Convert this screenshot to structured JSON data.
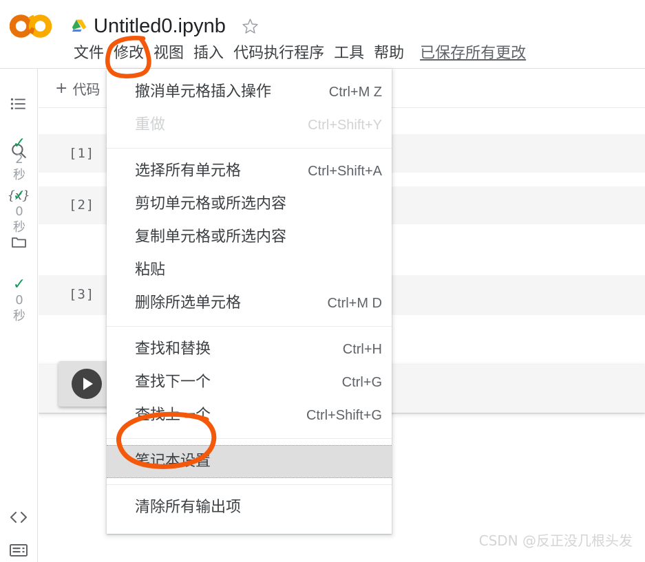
{
  "app": {
    "name": "Google Colaboratory",
    "logo_label": "CO"
  },
  "header": {
    "drive_icon": "drive-icon",
    "notebook_title": "Untitled0.ipynb",
    "star_icon": "star-icon",
    "menus": [
      {
        "label": "文件",
        "name": "menu-file"
      },
      {
        "label": "修改",
        "name": "menu-edit"
      },
      {
        "label": "视图",
        "name": "menu-view"
      },
      {
        "label": "插入",
        "name": "menu-insert"
      },
      {
        "label": "代码执行程序",
        "name": "menu-runtime"
      },
      {
        "label": "工具",
        "name": "menu-tools"
      },
      {
        "label": "帮助",
        "name": "menu-help"
      }
    ],
    "save_status": "已保存所有更改"
  },
  "sidebar": {
    "items": [
      {
        "name": "toc-icon",
        "label": "目录"
      },
      {
        "name": "search-icon",
        "label": "查找和替换"
      },
      {
        "name": "variables-icon",
        "label": "变量"
      },
      {
        "name": "files-icon",
        "label": "文件"
      }
    ],
    "bottom_items": [
      {
        "name": "code-snippets-icon",
        "label": "代码段"
      },
      {
        "name": "terminal-icon",
        "label": "终端"
      }
    ]
  },
  "toolbar": {
    "add_code_plus": "+",
    "add_code_label": "代码"
  },
  "notebook": {
    "run_button_label": "运行单元格",
    "cells": [
      {
        "label": "[1]",
        "status_icon": "check",
        "duration": "2",
        "duration_unit": "秒"
      },
      {
        "label": "[2]",
        "status_icon": "check",
        "duration": "0",
        "duration_unit": "秒"
      },
      {
        "label": "[3]",
        "status_icon": "check",
        "duration": "0",
        "duration_unit": "秒"
      }
    ]
  },
  "edit_menu": {
    "title": "修改",
    "groups": [
      {
        "items": [
          {
            "label": "撤消单元格插入操作",
            "shortcut": "Ctrl+M Z",
            "disabled": false,
            "highlighted": false,
            "name": "menu-item-undo"
          },
          {
            "label": "重做",
            "shortcut": "Ctrl+Shift+Y",
            "disabled": true,
            "highlighted": false,
            "name": "menu-item-redo"
          }
        ]
      },
      {
        "items": [
          {
            "label": "选择所有单元格",
            "shortcut": "Ctrl+Shift+A",
            "disabled": false,
            "highlighted": false,
            "name": "menu-item-select-all-cells"
          },
          {
            "label": "剪切单元格或所选内容",
            "shortcut": "",
            "disabled": false,
            "highlighted": false,
            "name": "menu-item-cut"
          },
          {
            "label": "复制单元格或所选内容",
            "shortcut": "",
            "disabled": false,
            "highlighted": false,
            "name": "menu-item-copy"
          },
          {
            "label": "粘贴",
            "shortcut": "",
            "disabled": false,
            "highlighted": false,
            "name": "menu-item-paste"
          },
          {
            "label": "删除所选单元格",
            "shortcut": "Ctrl+M D",
            "disabled": false,
            "highlighted": false,
            "name": "menu-item-delete-cells"
          }
        ]
      },
      {
        "items": [
          {
            "label": "查找和替换",
            "shortcut": "Ctrl+H",
            "disabled": false,
            "highlighted": false,
            "name": "menu-item-find-replace"
          },
          {
            "label": "查找下一个",
            "shortcut": "Ctrl+G",
            "disabled": false,
            "highlighted": false,
            "name": "menu-item-find-next"
          },
          {
            "label": "查找上一个",
            "shortcut": "Ctrl+Shift+G",
            "disabled": false,
            "highlighted": false,
            "name": "menu-item-find-previous"
          }
        ]
      },
      {
        "items": [
          {
            "label": "笔记本设置",
            "shortcut": "",
            "disabled": false,
            "highlighted": true,
            "name": "menu-item-notebook-settings"
          }
        ]
      },
      {
        "items": [
          {
            "label": "清除所有输出项",
            "shortcut": "",
            "disabled": false,
            "highlighted": false,
            "name": "menu-item-clear-all-outputs"
          }
        ]
      }
    ]
  },
  "annotations": {
    "color": "#F4580A",
    "circle_edit_menu": "修改",
    "circle_notebook_settings": "笔记本设置"
  },
  "watermark": {
    "text": "CSDN @反正没几根头发"
  },
  "colors": {
    "accent_orange": "#F4580A",
    "colab_orange": "#F9AB00",
    "colab_orange_dark": "#E8710A",
    "cell_bg": "#f5f5f5",
    "highlight_bg": "#dedede",
    "check_green": "#0F9D58",
    "text_primary": "#3c4043",
    "text_secondary": "#5f6368"
  }
}
